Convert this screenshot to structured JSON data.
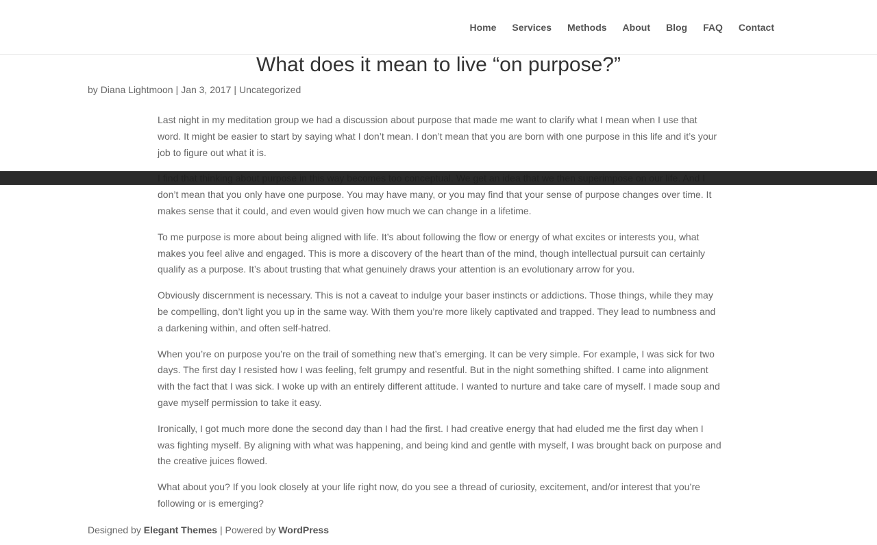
{
  "nav": {
    "items": [
      "Home",
      "Services",
      "Methods",
      "About",
      "Blog",
      "FAQ",
      "Contact"
    ]
  },
  "post": {
    "title": "What does it mean to live “on purpose?”",
    "meta": {
      "prefix": "by",
      "author": "Diana Lightmoon",
      "separator": "|",
      "date": "Jan 3, 2017",
      "category": "Uncategorized"
    },
    "paragraphs": [
      "Last night in my meditation group we had a discussion about purpose that made me want to clarify what I mean when I use that word. It might be easier to start by saying what I don’t mean. I don’t mean that you are born with one purpose in this life and it’s your job to figure out what it is.",
      "I find that thinking about purpose in this way becomes too conceptual. We get an idea that we then superimpose on our life. And I don’t mean that you only have one purpose. You may have many, or you may find that your sense of purpose changes over time. It makes sense that it could, and even would given how much we can change in a lifetime.",
      "To me purpose is more about being aligned with life. It’s about following the flow or energy of what excites or interests you, what makes you feel alive and engaged. This is more a discovery of the heart than of the mind, though intellectual pursuit can certainly qualify as a purpose. It’s about trusting that what genuinely draws your attention is an evolutionary arrow for you.",
      "Obviously discernment is necessary. This is not a caveat to indulge your baser instincts or addictions. Those things, while they may be compelling, don’t light you up in the same way. With them you’re more likely captivated and trapped. They lead to numbness and a darkening within, and often self-hatred.",
      "When you’re on purpose you’re on the trail of something new that’s emerging. It can be very simple. For example, I was sick for two days. The first day I resisted how I was feeling, felt grumpy and resentful. But in the night something shifted. I came into alignment with the fact that I was sick. I woke up with an entirely different attitude. I wanted to nurture and take care of myself. I made soup and gave myself permission to take it easy.",
      "Ironically, I got much more done the second day than I had the first. I had creative energy that had eluded me the first day when I was fighting myself. By aligning with what was happening, and being kind and gentle with myself, I was brought back on purpose and the creative juices flowed.",
      "What about you? If you look closely at your life right now, do you see a thread of curiosity, excitement, and/or interest that you’re following or is emerging?"
    ]
  },
  "footer": {
    "designed_by": "Designed by",
    "theme_link": "Elegant Themes",
    "separator": "|",
    "powered_by": "Powered by",
    "platform_link": "WordPress"
  },
  "colors": {
    "nav_text": "#555555",
    "title": "#333333",
    "body_text": "#666666",
    "overlay_band": "#1a1a1a"
  }
}
